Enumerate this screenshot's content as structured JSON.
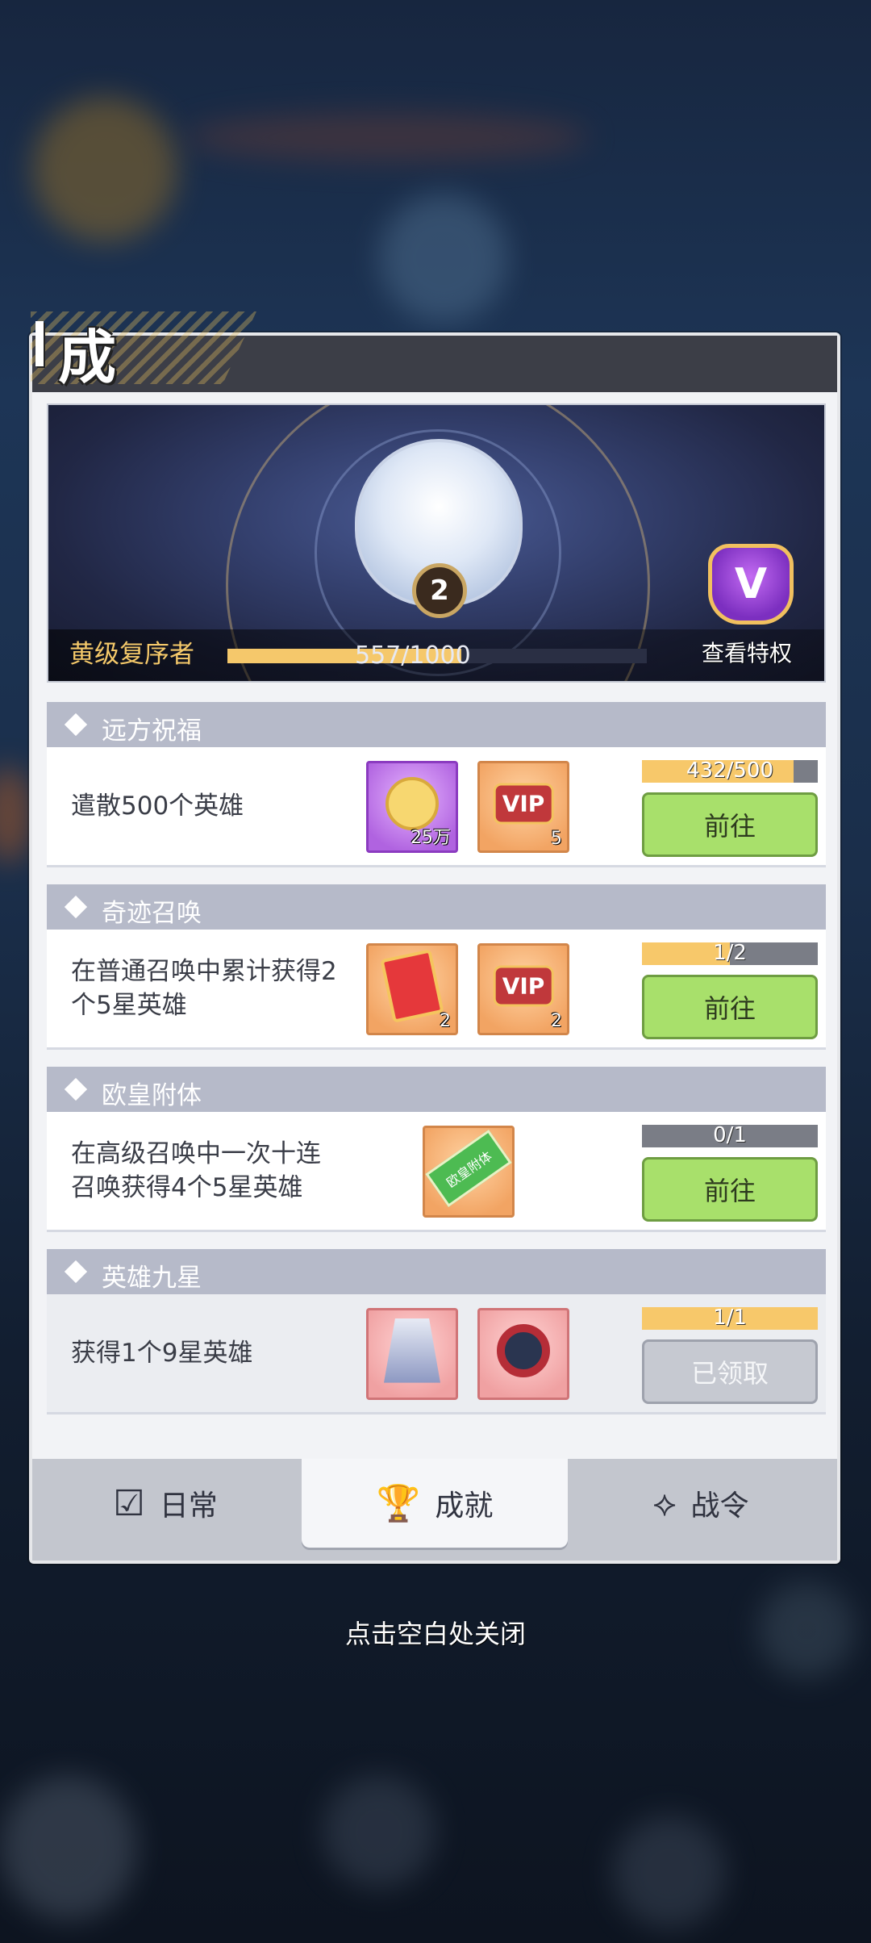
{
  "title": "成就",
  "banner": {
    "level": "2",
    "rank_name": "黄级复序者",
    "xp_text": "557/1000",
    "xp_fraction": 0.557,
    "privilege_label": "查看特权",
    "privilege_icon_letter": "V"
  },
  "achievements": [
    {
      "name": "远方祝福",
      "task": "遣散500个英雄",
      "rewards": [
        {
          "icon": "gold-coin",
          "qty": "25万",
          "frame": "purple"
        },
        {
          "icon": "vip-badge",
          "qty": "5",
          "frame": "orange"
        }
      ],
      "progress_text": "432/500",
      "progress_fraction": 0.864,
      "button": "前往"
    },
    {
      "name": "奇迹召唤",
      "task": "在普通召唤中累计获得2个5星英雄",
      "rewards": [
        {
          "icon": "summon-card",
          "qty": "2",
          "frame": "orange"
        },
        {
          "icon": "vip-badge",
          "qty": "2",
          "frame": "orange"
        }
      ],
      "progress_text": "1/2",
      "progress_fraction": 0.5,
      "button": "前往"
    },
    {
      "name": "欧皇附体",
      "task": "在高级召唤中一次十连召唤获得4个5星英雄",
      "rewards": [
        {
          "icon": "title-ticket",
          "qty": "",
          "frame": "orange",
          "ticket_text": "欧皇附体"
        }
      ],
      "progress_text": "0/1",
      "progress_fraction": 0,
      "button": "前往"
    },
    {
      "name": "英雄九星",
      "task": "获得1个9星英雄",
      "rewards": [
        {
          "icon": "cape-costume",
          "qty": "",
          "frame": "pink"
        },
        {
          "icon": "ring-accessory",
          "qty": "",
          "frame": "pink"
        }
      ],
      "progress_text": "1/1",
      "progress_fraction": 1,
      "button": "已领取"
    }
  ],
  "tabs": [
    {
      "label": "日常",
      "icon": "checklist-icon"
    },
    {
      "label": "成就",
      "icon": "trophy-icon"
    },
    {
      "label": "战令",
      "icon": "battle-pass-icon"
    }
  ],
  "active_tab": "成就",
  "close_hint": "点击空白处关闭",
  "colors": {
    "go_button": "#a8e06b",
    "progress": "#f7c86a",
    "header": "#3c3e47",
    "card_head": "#b6bac9"
  }
}
